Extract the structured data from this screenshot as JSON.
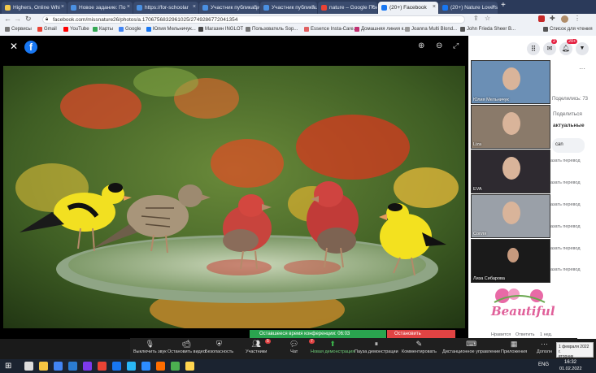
{
  "browser": {
    "tabs": [
      {
        "label": "Highers, Online Whi",
        "color": "#f2c94c"
      },
      {
        "label": "Новое задание: По",
        "color": "#4a90e2"
      },
      {
        "label": "https://for-schoolar",
        "color": "#4a90e2"
      },
      {
        "label": "Участник публикаци",
        "color": "#4a90e2"
      },
      {
        "label": "Участник публикаци",
        "color": "#4a90e2"
      },
      {
        "label": "nature – Google Пои",
        "color": "#ea4335"
      },
      {
        "label": "(20+) Facebook",
        "color": "#1877f2"
      },
      {
        "label": "(20+) Nature Lovers",
        "color": "#1877f2"
      }
    ],
    "new_tab": "+",
    "url": "facebook.com/missnature26/photos/a.1706756832961025/2749286772041354",
    "bookmarks": [
      {
        "label": "Сервисы",
        "color": "#777777"
      },
      {
        "label": "Gmail",
        "color": "#ea4335"
      },
      {
        "label": "YouTube",
        "color": "#ff0000"
      },
      {
        "label": "Карты",
        "color": "#34a853"
      },
      {
        "label": "Google",
        "color": "#4285f4"
      },
      {
        "label": "Юлия Мельничук...",
        "color": "#1877f2"
      },
      {
        "label": "Магазин INGLOT",
        "color": "#444444"
      },
      {
        "label": "Пользователь Sop...",
        "color": "#777777"
      },
      {
        "label": "Essence Insta-Care...",
        "color": "#e06060"
      },
      {
        "label": "Домашняя линия к...",
        "color": "#c03070"
      },
      {
        "label": "Joanna Multi Blond...",
        "color": "#999999"
      },
      {
        "label": "John Frieda Sheer B...",
        "color": "#555555"
      },
      {
        "label": "Список для чтения",
        "color": "#555555"
      }
    ]
  },
  "facebook": {
    "header_badges": {
      "messenger": "2",
      "notifications": "20+"
    },
    "side_texts": {
      "more": "···",
      "shares": "Поделились: 73",
      "share": "Поделиться",
      "relevant": "актуальные",
      "comment_fragment": "can",
      "translate": "азать перевод",
      "likes": "Нравится",
      "reply": "Ответить",
      "time": "1 нед."
    },
    "sticker_text": "Beautiful"
  },
  "participants": [
    {
      "name": "Юлия Мельничук",
      "bg": "#6b8fb5"
    },
    {
      "name": "Liza",
      "bg": "#8a7a6a"
    },
    {
      "name": "EVA",
      "bg": "#2e2a30"
    },
    {
      "name": "Сопля",
      "bg": "#9aa0a8"
    },
    {
      "name": "Лиза Сибарова",
      "bg": "#1a1a1a"
    }
  ],
  "zoom": {
    "timer_text": "Оставшееся время конференции: 06:03",
    "stop_share": "Остановить демонстрацию",
    "buttons": [
      {
        "label": "Выключить звук",
        "icon": "microphone-icon"
      },
      {
        "label": "Остановить видео",
        "icon": "video-camera-icon"
      },
      {
        "label": "Безопасность",
        "icon": "shield-icon"
      },
      {
        "label": "Участники",
        "icon": "participants-icon",
        "badge": "5"
      },
      {
        "label": "Чат",
        "icon": "chat-icon",
        "badge": "7"
      },
      {
        "label": "Новая демонстрация",
        "icon": "share-screen-icon"
      },
      {
        "label": "Пауза демонстрации",
        "icon": "pause-icon"
      },
      {
        "label": "Комментировать",
        "icon": "pencil-icon"
      },
      {
        "label": "Дистанционное управление",
        "icon": "remote-control-icon"
      },
      {
        "label": "Приложения",
        "icon": "apps-icon"
      },
      {
        "label": "Дополн",
        "icon": "more-icon"
      }
    ]
  },
  "taskbar": {
    "lang": "ENG",
    "time": "16:32",
    "date": "01.02.2022",
    "tooltip": "1 февраля 2022 г.",
    "tooltip2": "вторник"
  }
}
